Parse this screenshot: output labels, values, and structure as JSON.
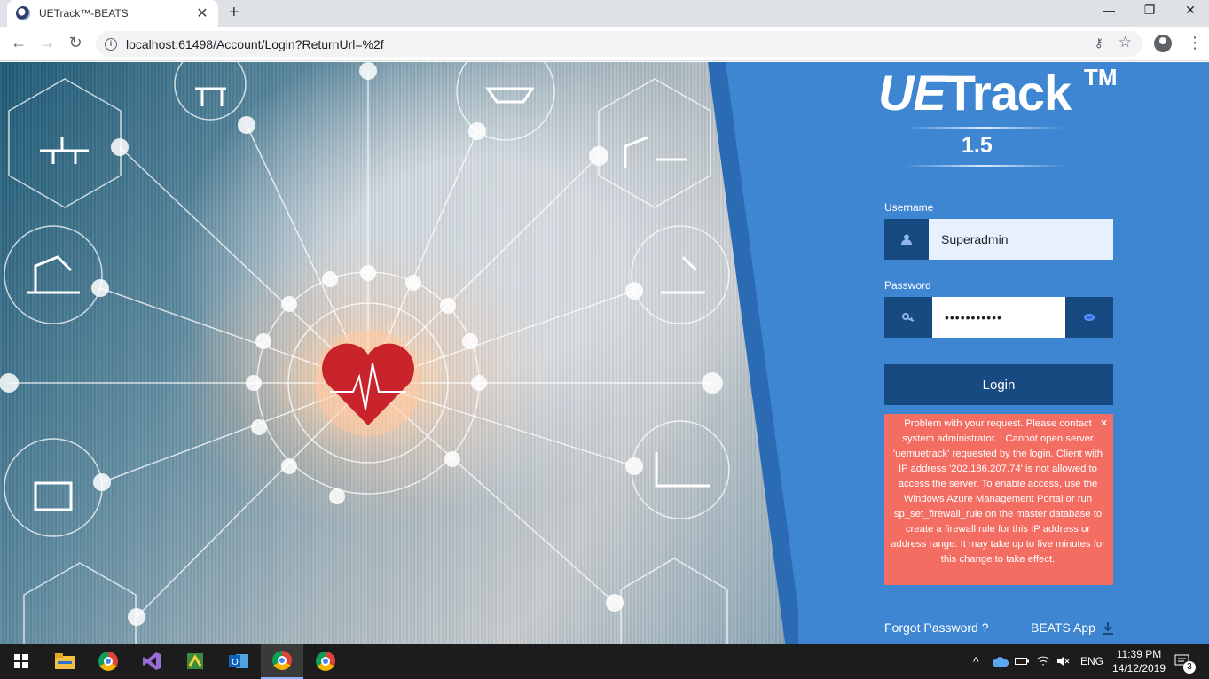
{
  "browser": {
    "tab_title": "UETrack™-BEATS",
    "tab_close": "✕",
    "new_tab": "+",
    "url": "localhost:61498/Account/Login?ReturnUrl=%2f",
    "window_controls": [
      "—",
      "❐",
      "✕"
    ]
  },
  "brand": {
    "logo_italic": "UE",
    "logo_rest": "Track",
    "trademark": "TM",
    "version": "1.5"
  },
  "form": {
    "username_label": "Username",
    "username_value": "Superadmin",
    "password_label": "Password",
    "password_value": "•••••••••••",
    "login_label": "Login"
  },
  "alert": {
    "message": "Problem with your request. Please contact system administrator. : Cannot open server 'uemuetrack' requested by the login. Client with IP address '202.186.207.74' is not allowed to access the server. To enable access, use the Windows Azure Management Portal or run sp_set_firewall_rule on the master database to create a firewall rule for this IP address or address range. It may take up to five minutes for this change to take effect.",
    "close": "×",
    "color": "#f46d62"
  },
  "links": {
    "forgot_password": "Forgot Password ?",
    "beats_app": "BEATS App"
  },
  "taskbar": {
    "language": "ENG",
    "time": "11:39 PM",
    "date": "14/12/2019",
    "notification_count": "3"
  },
  "colors": {
    "panel_bg": "#3e86d2",
    "dark_blue": "#174a80"
  }
}
